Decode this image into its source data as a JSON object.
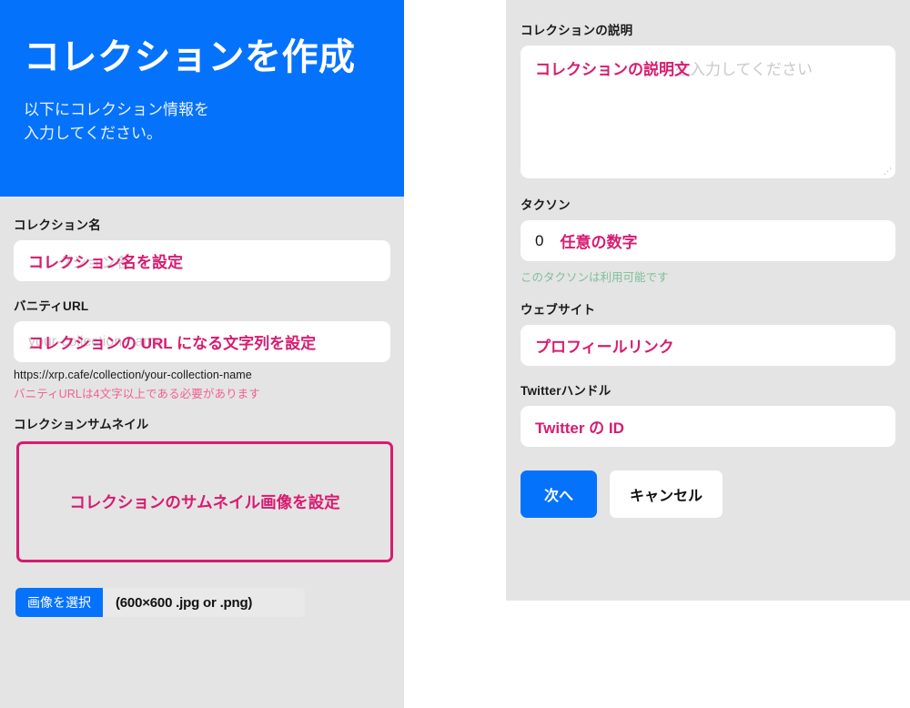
{
  "colors": {
    "brand_blue": "#0572fc",
    "accent_pink": "#d81b70",
    "panel_gray": "#e4e4e4",
    "error_pink": "#f06292",
    "success_green": "#7fbf9a"
  },
  "hero": {
    "title": "コレクションを作成",
    "subtitle": "以下にコレクション情報を入力してください。"
  },
  "left_form": {
    "name_field": {
      "label": "コレクション名",
      "placeholder": "コレクション名",
      "overlay_text": "コレクション名を設定"
    },
    "vanity_url_field": {
      "label": "バニティURL",
      "placeholder": "your-collection-name",
      "overlay_text": "コレクションの URL になる文字列を設定",
      "help": "https://xrp.cafe/collection/your-collection-name",
      "error": "バニティURLは4文字以上である必要があります"
    },
    "thumbnail": {
      "label": "コレクションサムネイル",
      "dropzone_text": "コレクションのサムネイル画像を設定",
      "select_button": "画像を選択",
      "hint": "(600×600 .jpg or .png)"
    }
  },
  "right_form": {
    "description_field": {
      "label": "コレクションの説明",
      "placeholder": "コレクションの説明を入力してください",
      "overlay_text": "コレクションの説明文",
      "resize_grip": "⋰"
    },
    "taxon_field": {
      "label": "タクソン",
      "value": "0",
      "overlay_text": "任意の数字",
      "status": "このタクソンは利用可能です"
    },
    "website_field": {
      "label": "ウェブサイト",
      "overlay_text": "プロフィールリンク"
    },
    "twitter_field": {
      "label": "Twitterハンドル",
      "overlay_text": "Twitter の ID"
    },
    "actions": {
      "next": "次へ",
      "cancel": "キャンセル"
    }
  }
}
